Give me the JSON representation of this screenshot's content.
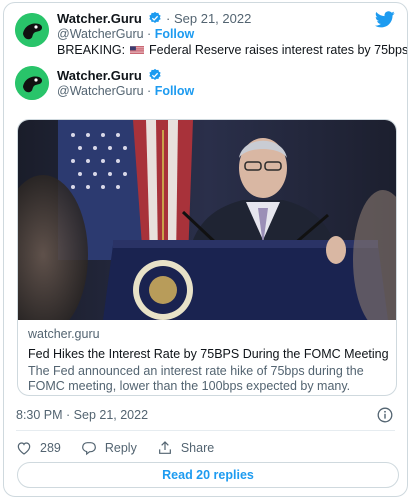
{
  "quoted": {
    "name": "Watcher.Guru",
    "date": "Sep 21, 2022",
    "handle": "@WatcherGuru",
    "follow_label": "Follow",
    "breaking_prefix": "BREAKING:",
    "flag_icon": "us-flag-icon",
    "text": "Federal Reserve raises interest rates by 75bps."
  },
  "tweet": {
    "name": "Watcher.Guru",
    "handle": "@WatcherGuru",
    "follow_label": "Follow",
    "timestamp": "8:30 PM · Sep 21, 2022"
  },
  "link_card": {
    "domain": "watcher.guru",
    "title": "Fed Hikes the Interest Rate by 75BPS During the FOMC Meeting",
    "description": "The Fed announced an interest rate hike of 75bps during the FOMC meeting, lower than the 100bps expected by many."
  },
  "actions": {
    "like_count": "289",
    "reply_label": "Reply",
    "share_label": "Share"
  },
  "read_replies_label": "Read 20 replies",
  "colors": {
    "accent": "#1d9bf0",
    "avatar_bg": "#29c46a",
    "text_muted": "#536471"
  }
}
